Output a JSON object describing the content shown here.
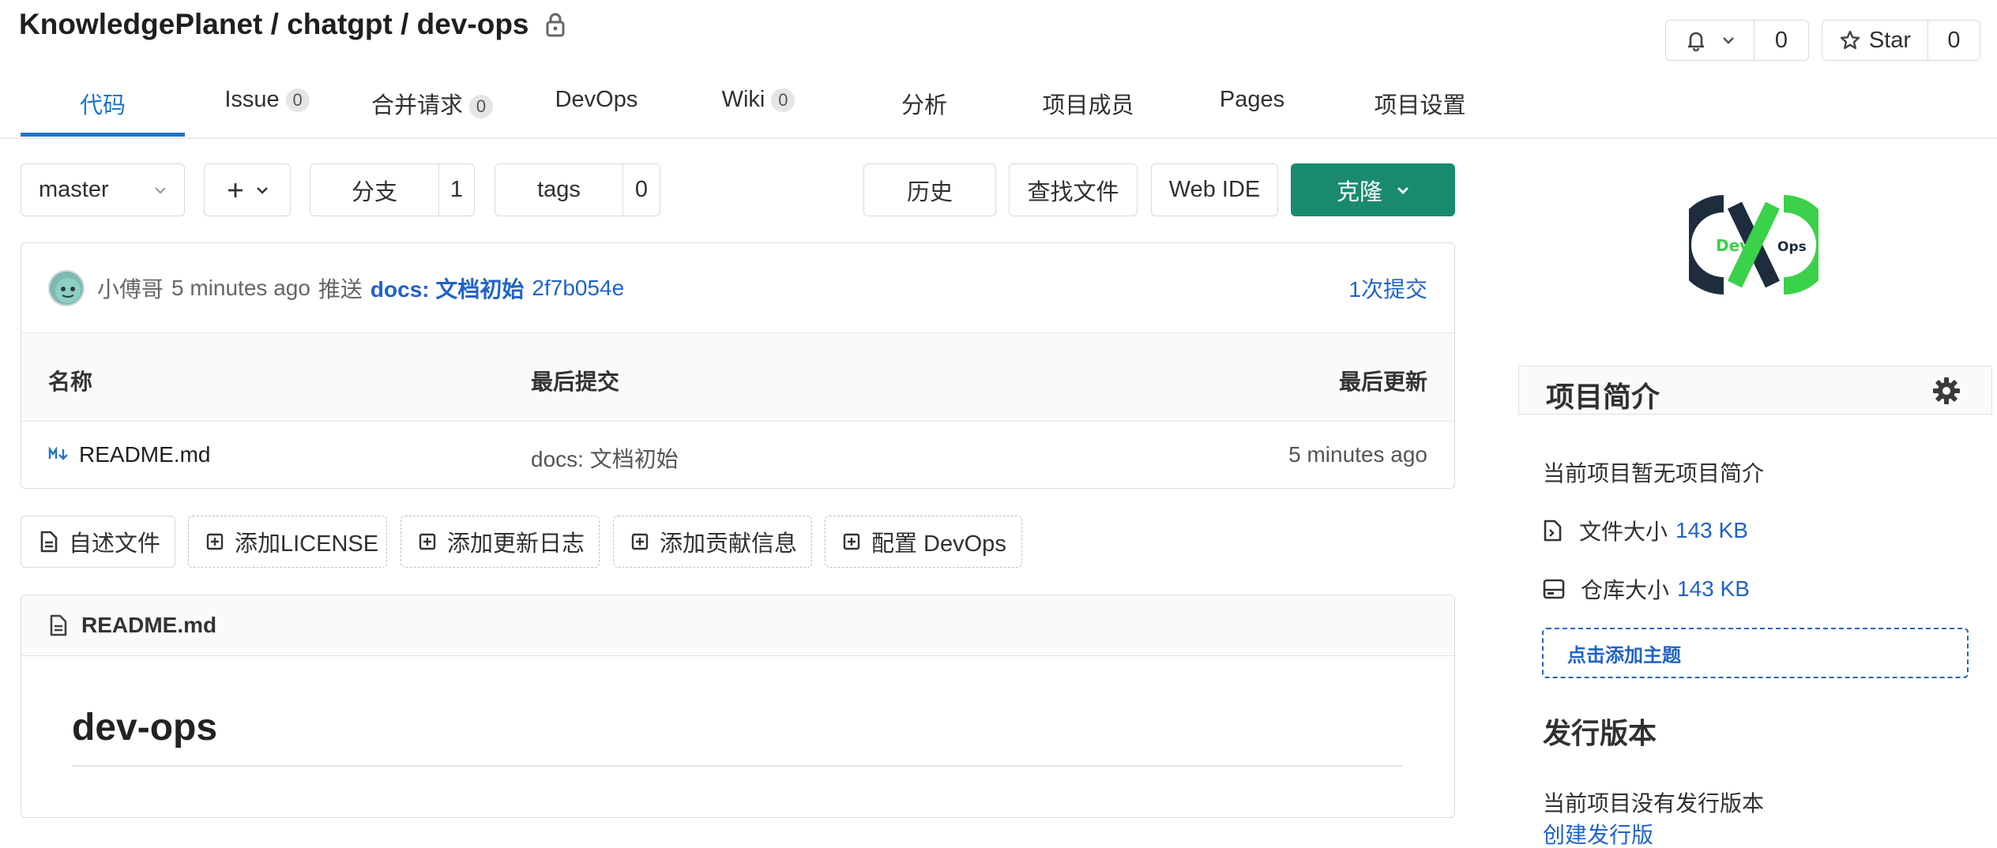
{
  "header": {
    "breadcrumb": "KnowledgePlanet / chatgpt / dev-ops",
    "notify_count": "0",
    "star_label": "Star",
    "star_count": "0"
  },
  "tabs": [
    {
      "label": "代码",
      "badge": null,
      "active": true
    },
    {
      "label": "Issue",
      "badge": "0"
    },
    {
      "label": "合并请求",
      "badge": "0"
    },
    {
      "label": "DevOps",
      "badge": null
    },
    {
      "label": "Wiki",
      "badge": "0"
    },
    {
      "label": "分析",
      "badge": null
    },
    {
      "label": "项目成员",
      "badge": null
    },
    {
      "label": "Pages",
      "badge": null
    },
    {
      "label": "项目设置",
      "badge": null
    }
  ],
  "toolbar": {
    "branch": "master",
    "branches_label": "分支",
    "branches_count": "1",
    "tags_label": "tags",
    "tags_count": "0",
    "history": "历史",
    "find_file": "查找文件",
    "web_ide": "Web IDE",
    "clone": "克隆"
  },
  "commit": {
    "author": "小傅哥",
    "time": "5 minutes ago",
    "action": "推送",
    "message": "docs: 文档初始",
    "sha": "2f7b054e",
    "count": "1次提交"
  },
  "file_table": {
    "headers": [
      "名称",
      "最后提交",
      "最后更新"
    ],
    "rows": [
      {
        "name": "README.md",
        "last_commit": "docs: 文档初始",
        "updated": "5 minutes ago"
      }
    ]
  },
  "quick_actions": [
    {
      "label": "自述文件",
      "icon": "file-icon"
    },
    {
      "label": "添加LICENSE",
      "icon": "plus-square-icon"
    },
    {
      "label": "添加更新日志",
      "icon": "plus-square-icon"
    },
    {
      "label": "添加贡献信息",
      "icon": "plus-square-icon"
    },
    {
      "label": "配置 DevOps",
      "icon": "plus-square-icon"
    }
  ],
  "readme": {
    "filename": "README.md",
    "heading": "dev-ops"
  },
  "sidebar": {
    "logo_text_left": "Dev",
    "logo_text_right": "Ops",
    "intro_title": "项目简介",
    "intro_empty": "当前项目暂无项目简介",
    "file_size_label": "文件大小",
    "file_size_value": "143 KB",
    "repo_size_label": "仓库大小",
    "repo_size_value": "143 KB",
    "add_topic": "点击添加主题",
    "release_title": "发行版本",
    "release_empty": "当前项目没有发行版本",
    "create_release": "创建发行版"
  },
  "colors": {
    "accent": "#1f63c6",
    "clone_bg": "#1a8a6f",
    "active_tab": "#1f75cb",
    "logo_green": "#3bd14a",
    "logo_dark": "#1e2d3d"
  }
}
